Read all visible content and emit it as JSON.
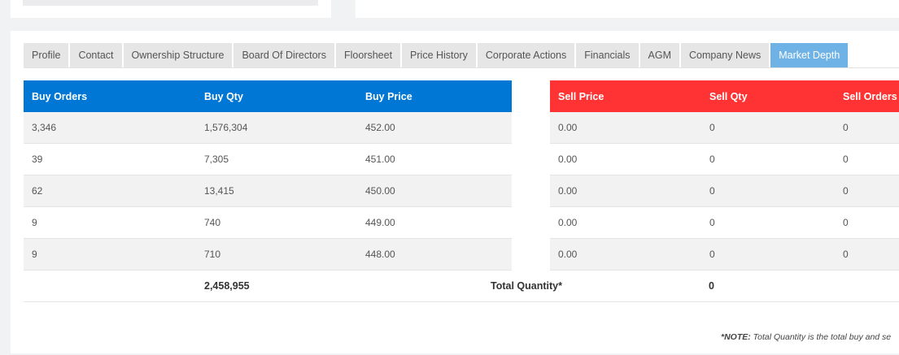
{
  "tabs": [
    {
      "label": "Profile"
    },
    {
      "label": "Contact"
    },
    {
      "label": "Ownership Structure"
    },
    {
      "label": "Board Of Directors"
    },
    {
      "label": "Floorsheet"
    },
    {
      "label": "Price History"
    },
    {
      "label": "Corporate Actions"
    },
    {
      "label": "Financials"
    },
    {
      "label": "AGM"
    },
    {
      "label": "Company News"
    },
    {
      "label": "Market Depth"
    }
  ],
  "active_tab": "Market Depth",
  "buy": {
    "headers": [
      "Buy Orders",
      "Buy Qty",
      "Buy Price"
    ],
    "rows": [
      [
        "3,346",
        "1,576,304",
        "452.00"
      ],
      [
        "39",
        "7,305",
        "451.00"
      ],
      [
        "62",
        "13,415",
        "450.00"
      ],
      [
        "9",
        "740",
        "449.00"
      ],
      [
        "9",
        "710",
        "448.00"
      ]
    ]
  },
  "sell": {
    "headers": [
      "Sell Price",
      "Sell Qty",
      "Sell Orders"
    ],
    "rows": [
      [
        "0.00",
        "0",
        "0"
      ],
      [
        "0.00",
        "0",
        "0"
      ],
      [
        "0.00",
        "0",
        "0"
      ],
      [
        "0.00",
        "0",
        "0"
      ],
      [
        "0.00",
        "0",
        "0"
      ]
    ]
  },
  "totals": {
    "buy_qty": "2,458,955",
    "label": "Total Quantity*",
    "sell_qty": "0"
  },
  "note": {
    "prefix": "*NOTE:",
    "text": "Total Quantity is the total buy and se"
  },
  "colors": {
    "buy_header": "#0077d4",
    "sell_header": "#ff3333",
    "active_tab": "#6fb3e6"
  }
}
